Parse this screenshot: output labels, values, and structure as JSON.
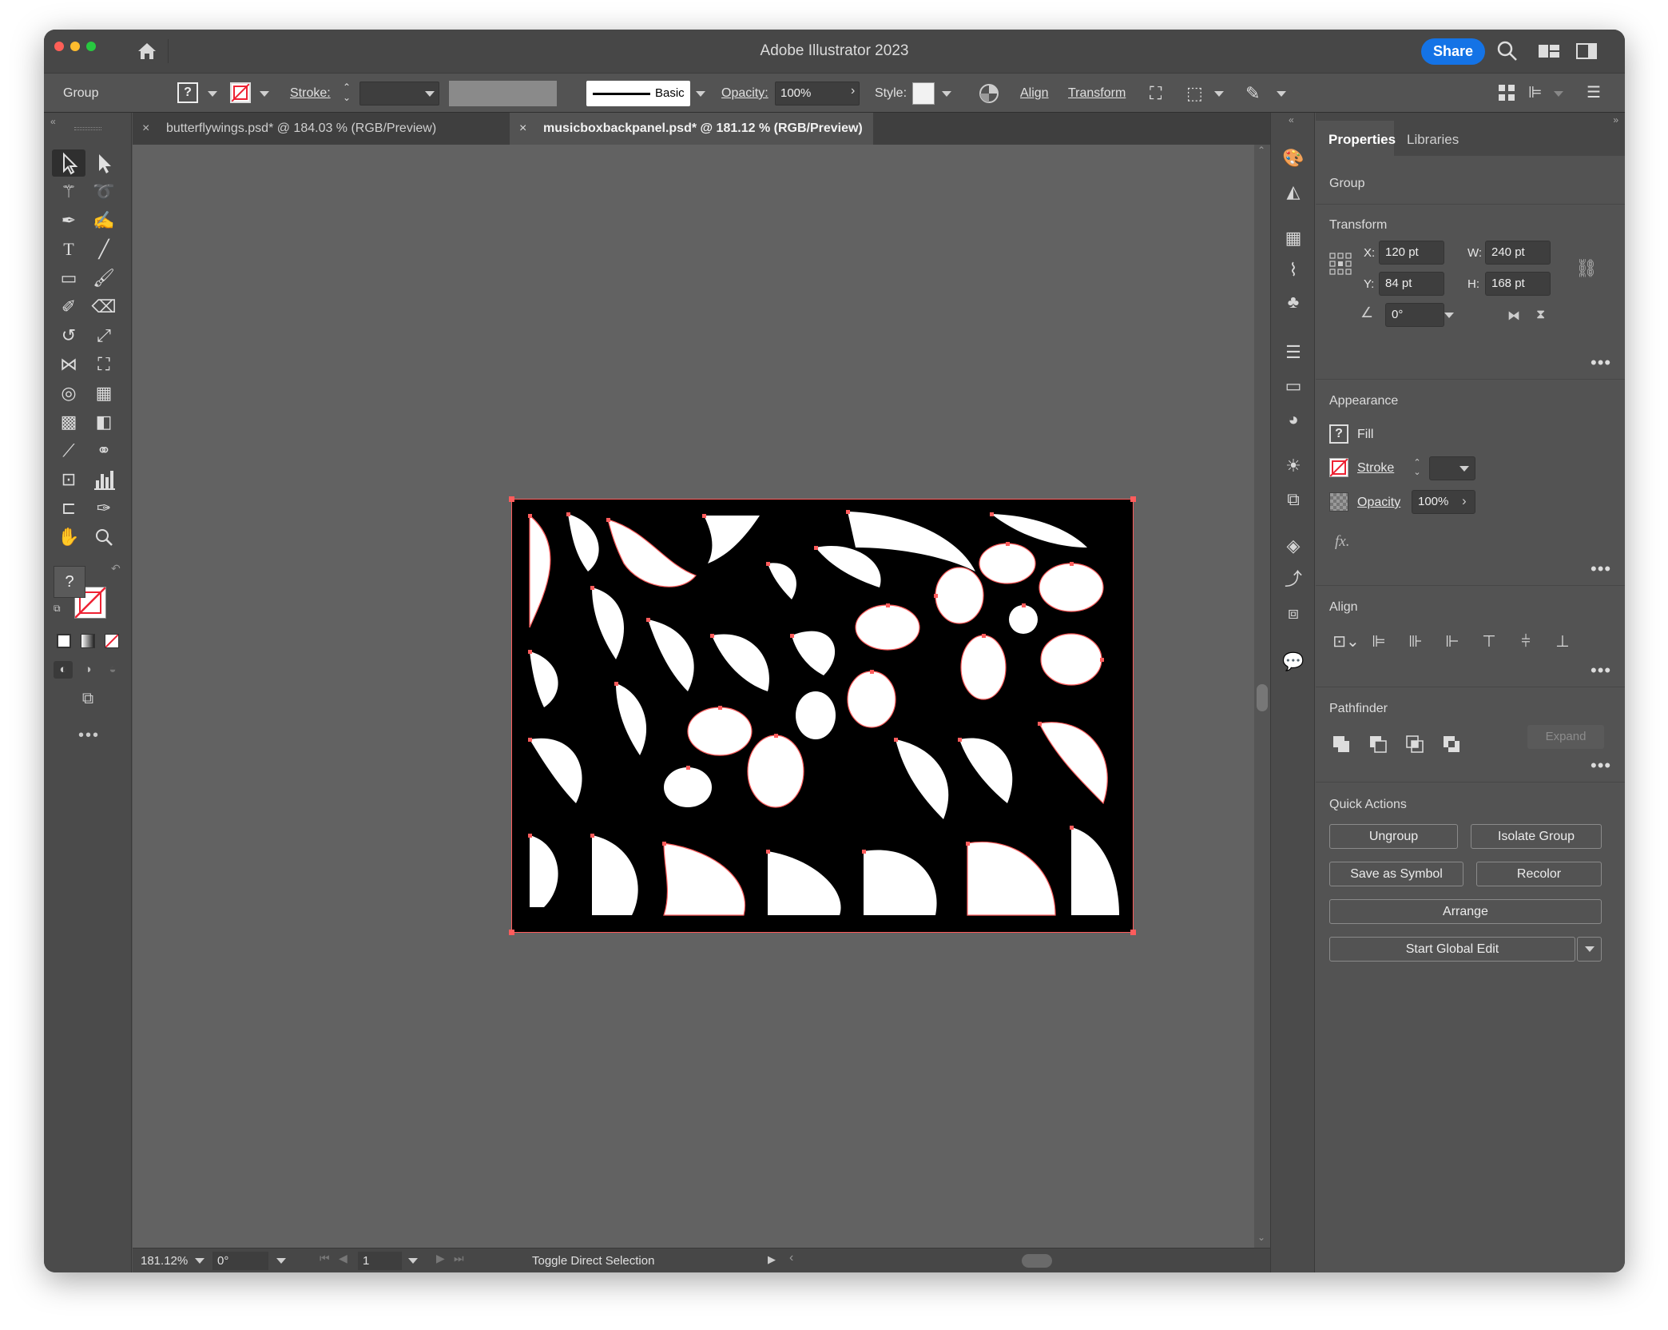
{
  "app": {
    "title": "Adobe Illustrator 2023",
    "share_label": "Share"
  },
  "control_bar": {
    "selection_type": "Group",
    "fill_value": "?",
    "stroke_label": "Stroke:",
    "brush_label": "Basic",
    "opacity_label": "Opacity:",
    "opacity_value": "100%",
    "style_label": "Style:",
    "align_label": "Align",
    "transform_label": "Transform"
  },
  "tabs": [
    {
      "label": "butterflywings.psd* @ 184.03 % (RGB/Preview)",
      "active": false
    },
    {
      "label": "musicboxbackpanel.psd* @ 181.12 % (RGB/Preview)",
      "active": true
    }
  ],
  "toolbar": {
    "fill_value": "?"
  },
  "status_bar": {
    "zoom": "181.12%",
    "rotation": "0°",
    "artboard_number": "1",
    "status_text": "Toggle Direct Selection"
  },
  "properties": {
    "tab_properties": "Properties",
    "tab_libraries": "Libraries",
    "selection": "Group",
    "transform": {
      "title": "Transform",
      "x_label": "X:",
      "x": "120 pt",
      "y_label": "Y:",
      "y": "84 pt",
      "w_label": "W:",
      "w": "240 pt",
      "h_label": "H:",
      "h": "168 pt",
      "angle": "0°"
    },
    "appearance": {
      "title": "Appearance",
      "fill_label": "Fill",
      "fill_value": "?",
      "stroke_label": "Stroke",
      "opacity_label": "Opacity",
      "opacity_value": "100%",
      "fx_label": "fx."
    },
    "align": {
      "title": "Align"
    },
    "pathfinder": {
      "title": "Pathfinder",
      "expand_label": "Expand"
    },
    "quick_actions": {
      "title": "Quick Actions",
      "ungroup": "Ungroup",
      "isolate_group": "Isolate Group",
      "save_as_symbol": "Save as Symbol",
      "recolor": "Recolor",
      "arrange": "Arrange",
      "start_global_edit": "Start Global Edit"
    }
  },
  "colors": {
    "accent": "#1473e6",
    "selection": "#ff5c5c",
    "canvas": "#626262",
    "panel": "#535353"
  }
}
